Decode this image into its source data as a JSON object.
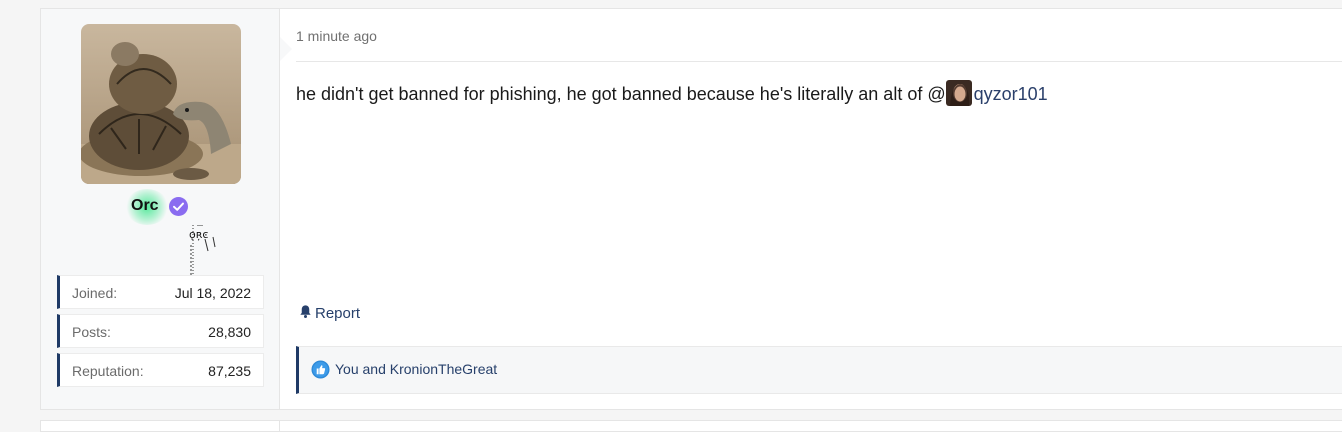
{
  "post": {
    "author": {
      "username": "Orc",
      "avatar_icon": "tortoise-avatar",
      "badge_icon": "verified-badge-icon",
      "badge_color": "#8a6cf0",
      "name_glow_color": "#3ce68c"
    },
    "stats": [
      {
        "label": "Joined:",
        "value": "Jul 18, 2022"
      },
      {
        "label": "Posts:",
        "value": "28,830"
      },
      {
        "label": "Reputation:",
        "value": "87,235"
      }
    ],
    "timestamp": "1 minute ago",
    "message": {
      "text": "he didn't get banned for phishing, he got banned because he's literally an alt of @",
      "mention": "qyzor101"
    },
    "actions": {
      "report_label": "Report",
      "report_icon": "bell-icon"
    },
    "reactions": {
      "icon": "thumbs-up-icon",
      "text": "You and KronionTheGreat"
    }
  },
  "colors": {
    "accent": "#1f3a66",
    "link": "#27406b"
  }
}
